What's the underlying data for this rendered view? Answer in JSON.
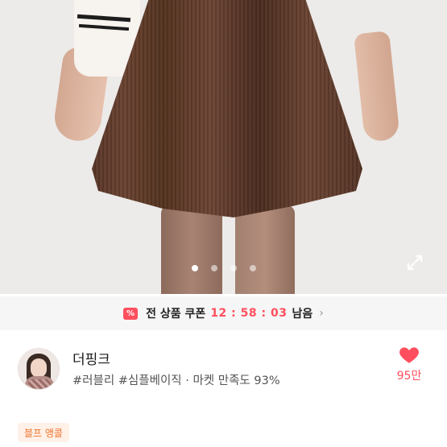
{
  "gallery": {
    "image_alt": "",
    "page_count": 4,
    "current_page": 1,
    "expand_icon": "expand-icon"
  },
  "coupon": {
    "badge": "%",
    "label": "전 상품 쿠폰",
    "countdown": "12 : 58 : 03",
    "suffix": "남음",
    "chevron": "›",
    "accent_color": "#ff4f5e"
  },
  "seller": {
    "name": "더핑크",
    "tags": "#러블리 #심플베이직 · 마켓 만족도 93%",
    "likes": "95만",
    "like_icon": "heart-icon",
    "like_color": "#ff4f5e"
  },
  "chip": {
    "label": "블프 앵콜",
    "color": "#f0722c"
  }
}
